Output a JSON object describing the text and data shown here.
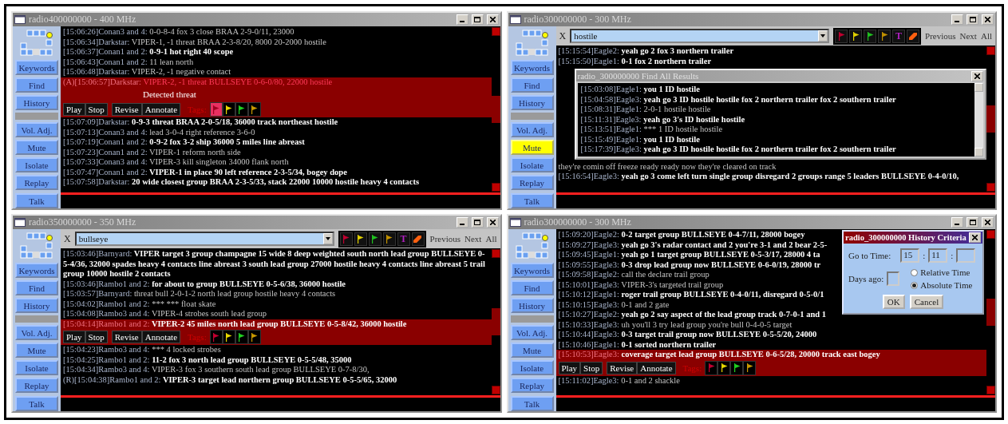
{
  "windows": [
    {
      "title": "radio400000000 - 400 MHz",
      "tools": [
        {
          "label": "Keywords",
          "active": false
        },
        {
          "label": "Find",
          "active": false
        },
        {
          "label": "History",
          "active": false
        }
      ],
      "audio": [
        {
          "label": "Vol. Adj.",
          "active": false
        },
        {
          "label": "Mute",
          "active": false
        },
        {
          "label": "Isolate",
          "active": false
        },
        {
          "label": "Replay",
          "active": false
        }
      ],
      "talk": "Talk",
      "messages": [
        {
          "kind": "message",
          "time": "[15:06:26]",
          "speaker": "Conan3 and 4:",
          "text": "0-0-8-4 fox 3 close BRAA 2-9-0/11, 23000",
          "emphasized": false,
          "selected": false
        },
        {
          "kind": "message",
          "time": "[15:06:34]",
          "speaker": "Darkstar:",
          "text": "VIPER-1, -1 threat BRAA 2-3-8/20, 8000 20-2000 hostile",
          "emphasized": false,
          "selected": false
        },
        {
          "kind": "message",
          "time": "[15:06:37]",
          "speaker": "Conan1 and 2:",
          "text": "0-9-1 hot right 40 scope",
          "emphasized": true,
          "selected": false
        },
        {
          "kind": "message",
          "time": "[15:06:43]",
          "speaker": "Conan1 and 2:",
          "text": "11 lean north",
          "emphasized": false,
          "selected": false
        },
        {
          "kind": "message",
          "time": "[15:06:48]",
          "speaker": "Darkstar:",
          "text": "VIPER-2, -1 negative contact",
          "emphasized": false,
          "selected": false
        },
        {
          "kind": "message",
          "prefix": "(A)",
          "time": "[15:06:57]",
          "speaker": "Darkstar:",
          "text": "VIPER-2, -1 threat BULLSEYE 0-6-0/80, 22000 hostile",
          "emphasized": false,
          "selected": true,
          "note": "Detected threat",
          "actions": [
            [
              "Play",
              "Stop"
            ],
            [
              "Revise",
              "Annotate"
            ]
          ],
          "tags_label": "Tags:",
          "tags": [
            {
              "color": "#a00020",
              "selected": true
            },
            {
              "color": "#e8d800",
              "selected": false
            },
            {
              "color": "#20d020",
              "selected": false
            },
            {
              "color": "#c89800",
              "selected": false
            }
          ]
        },
        {
          "kind": "message",
          "time": "[15:07:09]",
          "speaker": "Darkstar:",
          "text": "0-9-3 threat BRAA 2-0-5/18, 36000 track northeast hostile",
          "emphasized": true,
          "selected": false
        },
        {
          "kind": "message",
          "time": "[15:07:13]",
          "speaker": "Conan3 and 4:",
          "text": "lead 3-0-4 right reference 3-6-0",
          "emphasized": false,
          "selected": false
        },
        {
          "kind": "message",
          "time": "[15:07:19]",
          "speaker": "Conan1 and 2:",
          "text": "0-9-2 fox 3-2 ship 36000 5 miles line abreast",
          "emphasized": true,
          "selected": false
        },
        {
          "kind": "message",
          "time": "[15:07:23]",
          "speaker": "Conan1 and 2:",
          "text": "VIPER-1 reform north side",
          "emphasized": false,
          "selected": false
        },
        {
          "kind": "message",
          "time": "[15:07:33]",
          "speaker": "Conan3 and 4:",
          "text": "VIPER-3 kill singleton 34000 flank north",
          "emphasized": false,
          "selected": false
        },
        {
          "kind": "message",
          "time": "[15:07:47]",
          "speaker": "Conan1 and 2:",
          "text": "VIPER-1 in place 90 left reference 2-3-5/34, bogey dope",
          "emphasized": true,
          "selected": false
        },
        {
          "kind": "message",
          "time": "[15:07:58]",
          "speaker": "Darkstar:",
          "text": "20 wide closest group BRAA 2-3-5/33, stack 22000 10000 hostile heavy 4 contacts",
          "emphasized": true,
          "selected": false
        }
      ]
    },
    {
      "title": "radio300000000 - 300 MHz",
      "tools": [
        {
          "label": "Keywords",
          "active": false
        },
        {
          "label": "Find",
          "active": false
        },
        {
          "label": "History",
          "active": false
        }
      ],
      "audio": [
        {
          "label": "Vol. Adj.",
          "active": false
        },
        {
          "label": "Mute",
          "active": true
        },
        {
          "label": "Isolate",
          "active": false
        },
        {
          "label": "Replay",
          "active": false
        }
      ],
      "talk": "Talk",
      "search": {
        "close": "X",
        "value": "hostile",
        "tags": [
          {
            "kind": "flag",
            "color": "#c00030"
          },
          {
            "kind": "flag",
            "color": "#e0d000"
          },
          {
            "kind": "flag",
            "color": "#20c020"
          },
          {
            "kind": "flag",
            "color": "#c09000"
          },
          {
            "kind": "letter",
            "label": "T",
            "color": "#b020c0"
          },
          {
            "kind": "marker",
            "color": "#ff6010"
          }
        ],
        "nav": [
          "Previous",
          "Next",
          "All"
        ]
      },
      "messages": [
        {
          "kind": "message",
          "time": "[15:15:54]",
          "speaker": "Eagle2:",
          "text": "yeah go 2 fox 3 northern trailer",
          "emphasized": true,
          "selected": false
        },
        {
          "kind": "message",
          "time": "[15:15:50]",
          "speaker": "Eagle1:",
          "text": "0-1 fox 2 northern trailer",
          "emphasized": true,
          "selected": false
        },
        {
          "kind": "results_popup",
          "title": "radio_300000000 Find All Results",
          "results": [
            {
              "time": "[15:03:08]",
              "speaker": "Eagle1:",
              "text": "you 1 ID hostile",
              "emphasized": true
            },
            {
              "time": "[15:04:58]",
              "speaker": "Eagle3:",
              "text": "yeah go 3 ID hostile hostile fox 2 northern trailer fox 2 southern trailer",
              "emphasized": true
            },
            {
              "time": "[15:08:31]",
              "speaker": "Eagle1:",
              "text": "2-0-1 hostile hostile",
              "emphasized": false
            },
            {
              "time": "[15:11:31]",
              "speaker": "Eagle3:",
              "text": "yeah go 3's ID hostile hostile",
              "emphasized": true
            },
            {
              "time": "[15:13:51]",
              "speaker": "Eagle1:",
              "text": "*** 1 ID hostile hostile",
              "emphasized": false
            },
            {
              "time": "[15:15:49]",
              "speaker": "Eagle1:",
              "text": "you 1 ID hostile",
              "emphasized": true
            },
            {
              "time": "[15:17:39]",
              "speaker": "Eagle3:",
              "text": "yeah go 3 ID hostile hostile fox 2 northern trailer fox 2 southern trailer",
              "emphasized": true
            }
          ]
        },
        {
          "kind": "message",
          "text": "they're comin off freeze ready ready now they're cleared on track",
          "emphasized": false,
          "selected": false
        },
        {
          "kind": "message",
          "time": "[15:16:54]",
          "speaker": "Eagle3:",
          "text": "yeah go 3 come left turn single group disregard 2 groups range 5 leaders BULLSEYE 0-4-0/10,",
          "emphasized": true,
          "selected": false
        }
      ]
    },
    {
      "title": "radio350000000 - 350 MHz",
      "tools": [
        {
          "label": "Keywords",
          "active": false
        },
        {
          "label": "Find",
          "active": false
        },
        {
          "label": "History",
          "active": false
        }
      ],
      "audio": [
        {
          "label": "Vol. Adj.",
          "active": false
        },
        {
          "label": "Mute",
          "active": false
        },
        {
          "label": "Isolate",
          "active": false
        },
        {
          "label": "Replay",
          "active": false
        }
      ],
      "talk": "Talk",
      "search": {
        "close": "X",
        "value": "bullseye",
        "tags": [
          {
            "kind": "flag",
            "color": "#c00030"
          },
          {
            "kind": "flag",
            "color": "#e0d000"
          },
          {
            "kind": "flag",
            "color": "#20c020"
          },
          {
            "kind": "flag",
            "color": "#c09000"
          },
          {
            "kind": "letter",
            "label": "T",
            "color": "#b020c0"
          },
          {
            "kind": "marker",
            "color": "#ff6010"
          }
        ],
        "nav": [
          "Previous",
          "Next",
          "All"
        ]
      },
      "messages": [
        {
          "kind": "message",
          "time": "[15:03:46]",
          "speaker": "Barnyard:",
          "text": "VIPER target 3 group champagne 15 wide 8 deep weighted south north lead group BULLSEYE 0-5-4/36, 32000 spades heavy 4 contacts line abreast 3 south lead group 27000 hostile heavy 4 contacts line abreast 5 trail group 10000 hostile 2 contacts",
          "emphasized": true,
          "selected": false
        },
        {
          "kind": "message",
          "time": "[15:03:46]",
          "speaker": "Rambo1 and 2:",
          "text": "for about to group BULLSEYE 0-5-6/38, 36000 hostile",
          "emphasized": true,
          "selected": false
        },
        {
          "kind": "message",
          "time": "[15:03:57]",
          "speaker": "Barnyard:",
          "text": "threat bull 2-0-1-2 north lead group hostile heavy 4 contacts",
          "emphasized": false,
          "selected": false
        },
        {
          "kind": "message",
          "time": "[15:04:02]",
          "speaker": "Rambo1 and 2:",
          "text": "*** *** float skate",
          "emphasized": false,
          "selected": false
        },
        {
          "kind": "message",
          "time": "[15:04:08]",
          "speaker": "Rambo3 and 4:",
          "text": "VIPER-4 strobes south lead group",
          "emphasized": false,
          "selected": false
        },
        {
          "kind": "message",
          "time": "[15:04:14]",
          "speaker": "Rambo1 and 2:",
          "text": "VIPER-2 45 miles north lead group BULLSEYE 0-5-8/42, 36000 hostile",
          "emphasized": true,
          "selected": true,
          "actions": [
            [
              "Play",
              "Stop"
            ],
            [
              "Revise",
              "Annotate"
            ]
          ],
          "tags_label": "Tags:",
          "tags": [
            {
              "color": "#c00030",
              "selected": false
            },
            {
              "color": "#e8d800",
              "selected": false
            },
            {
              "color": "#20d020",
              "selected": false
            },
            {
              "color": "#c89800",
              "selected": false
            }
          ]
        },
        {
          "kind": "message",
          "time": "[15:04:23]",
          "speaker": "Rambo3 and 4:",
          "text": "*** 4 locked strobes",
          "emphasized": false,
          "selected": false
        },
        {
          "kind": "message",
          "time": "[15:04:25]",
          "speaker": "Rambo1 and 2:",
          "text": "11-2 fox 3 north lead group BULLSEYE 0-5-5/48, 35000",
          "emphasized": true,
          "selected": false
        },
        {
          "kind": "message",
          "time": "[15:04:34]",
          "speaker": "Rambo3 and 4:",
          "text": "VIPER-3 fox 3 southern south lead group BULLSEYE 0-7-8/30,",
          "emphasized": false,
          "selected": false
        },
        {
          "kind": "message",
          "prefix": "(R)",
          "time": "[15:04:38]",
          "speaker": "Rambo1 and 2:",
          "text": "VIPER-3 target lead northern group BULLSEYE 0-5-5/65, 32000",
          "emphasized": true,
          "selected": false
        }
      ]
    },
    {
      "title": "radio300000000 - 300 MHz",
      "tools": [
        {
          "label": "Keywords",
          "active": false
        },
        {
          "label": "Find",
          "active": false
        },
        {
          "label": "History",
          "active": false
        }
      ],
      "audio": [
        {
          "label": "Vol. Adj.",
          "active": false
        },
        {
          "label": "Mute",
          "active": false
        },
        {
          "label": "Isolate",
          "active": false
        },
        {
          "label": "Replay",
          "active": false
        }
      ],
      "talk": "Talk",
      "dialog": {
        "title": "radio_300000000 History Criteria",
        "time_label": "Go to Time:",
        "hours": "15",
        "minutes": "11",
        "separators": [
          ":",
          ":"
        ],
        "days_label": "Days ago:",
        "radios": [
          {
            "label": "Relative Time",
            "selected": false
          },
          {
            "label": "Absolute Time",
            "selected": true
          }
        ],
        "buttons": [
          "OK",
          "Cancel"
        ]
      },
      "messages": [
        {
          "kind": "message",
          "time": "[15:09:20]",
          "speaker": "Eagle2:",
          "text": "0-2 target group BULLSEYE 0-4-7/11, 28000 bogey",
          "emphasized": true,
          "selected": false
        },
        {
          "kind": "message",
          "time": "[15:09:27]",
          "speaker": "Eagle3:",
          "text": "yeah go 3's radar contact and 2 you're 3-1 and 2 bear 2-5-",
          "emphasized": true,
          "selected": false
        },
        {
          "kind": "message",
          "time": "[15:09:45]",
          "speaker": "Eagle1:",
          "text": "yeah go 1 target group BULLSEYE 0-5-3/17, 28000 4 ta",
          "emphasized": true,
          "selected": false
        },
        {
          "kind": "message",
          "time": "[15:09:55]",
          "speaker": "Eagle3:",
          "text": "0-3 drop lead group now BULLSEYE 0-6-0/19, 28000 tr",
          "emphasized": true,
          "selected": false
        },
        {
          "kind": "message",
          "time": "[15:09:58]",
          "speaker": "Eagle2:",
          "text": "call the declare trail group",
          "emphasized": false,
          "selected": false
        },
        {
          "kind": "message",
          "time": "[15:10:01]",
          "speaker": "Eagle3:",
          "text": "VIPER-3's targeted trail group",
          "emphasized": false,
          "selected": false
        },
        {
          "kind": "message",
          "time": "[15:10:12]",
          "speaker": "Eagle1:",
          "text": "roger trail group BULLSEYE 0-4-0/11, disregard 0-5-0/1",
          "emphasized": true,
          "selected": false
        },
        {
          "kind": "message",
          "time": "[15:10:15]",
          "speaker": "Eagle3:",
          "text": "0-1 and 2 gate",
          "emphasized": false,
          "selected": false
        },
        {
          "kind": "message",
          "time": "[15:10:27]",
          "speaker": "Eagle2:",
          "text": "yeah go 2 say aspect of the lead group track 0-7-0-1 and 1",
          "emphasized": true,
          "selected": false
        },
        {
          "kind": "message",
          "time": "[15:10:33]",
          "speaker": "Eagle3:",
          "text": "uh you'll 3 try lead group you're bull 0-4-0-5 target",
          "emphasized": false,
          "selected": false
        },
        {
          "kind": "message",
          "time": "[15:10:44]",
          "speaker": "Eagle3:",
          "text": "0-3 target trail group now BULLSEYE 0-5-5/20, 24000",
          "emphasized": true,
          "selected": false
        },
        {
          "kind": "message",
          "time": "[15:10:46]",
          "speaker": "Eagle1:",
          "text": "0-1 sorted northern trailer",
          "emphasized": true,
          "selected": false
        },
        {
          "kind": "message",
          "time": "[15:10:53]",
          "speaker": "Eagle3:",
          "text": "coverage target lead group BULLSEYE 0-6-5/28, 20000 track east bogey",
          "emphasized": true,
          "selected": true,
          "actions": [
            [
              "Play",
              "Stop"
            ],
            [
              "Revise",
              "Annotate"
            ]
          ],
          "tags_label": "Tags:",
          "tags": [
            {
              "color": "#c00030",
              "selected": false
            },
            {
              "color": "#e8d800",
              "selected": false
            },
            {
              "color": "#20d020",
              "selected": false
            },
            {
              "color": "#c89800",
              "selected": false
            }
          ]
        },
        {
          "kind": "message",
          "time": "[15:11:02]",
          "speaker": "Eagle3:",
          "text": "0-1 and 2 shackle",
          "emphasized": false,
          "selected": false
        }
      ]
    }
  ]
}
